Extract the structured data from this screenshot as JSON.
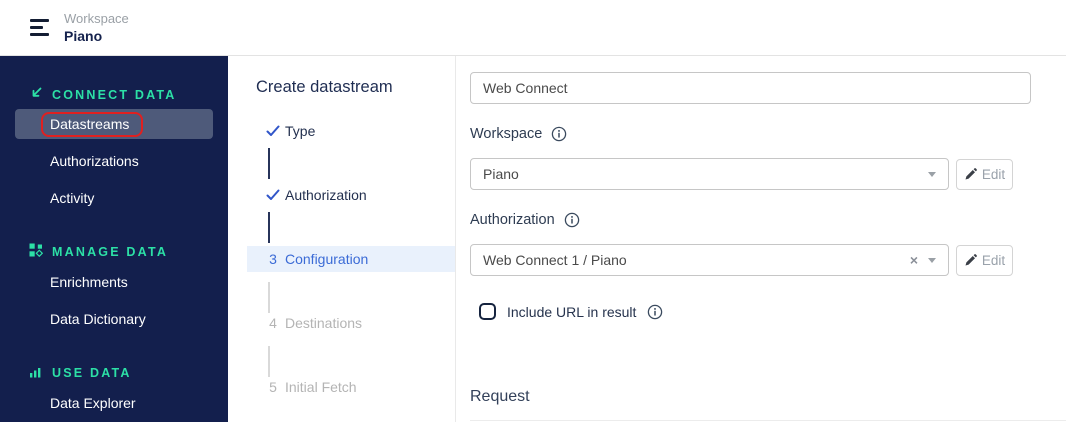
{
  "header": {
    "workspace_label": "Workspace",
    "workspace_name": "Piano"
  },
  "sidebar": {
    "sections": [
      {
        "title": "CONNECT DATA",
        "icon": "arrow-down-left-icon",
        "items": [
          {
            "label": "Datastreams",
            "selected": true,
            "annotated": true
          },
          {
            "label": "Authorizations"
          },
          {
            "label": "Activity"
          }
        ]
      },
      {
        "title": "MANAGE DATA",
        "icon": "modules-icon",
        "items": [
          {
            "label": "Enrichments"
          },
          {
            "label": "Data Dictionary"
          }
        ]
      },
      {
        "title": "USE DATA",
        "icon": "bar-chart-icon",
        "items": [
          {
            "label": "Data Explorer"
          }
        ]
      }
    ]
  },
  "wizard": {
    "title": "Create datastream",
    "steps": [
      {
        "label": "Type",
        "state": "completed"
      },
      {
        "label": "Authorization",
        "state": "completed"
      },
      {
        "number": "3",
        "label": "Configuration",
        "state": "active"
      },
      {
        "number": "4",
        "label": "Destinations",
        "state": "pending"
      },
      {
        "number": "5",
        "label": "Initial Fetch",
        "state": "pending"
      }
    ]
  },
  "form": {
    "name_value": "Web Connect",
    "workspace_label": "Workspace",
    "workspace_value": "Piano",
    "workspace_edit_label": "Edit",
    "authorization_label": "Authorization",
    "authorization_value": "Web Connect 1 / Piano",
    "authorization_edit_label": "Edit",
    "include_url_label": "Include URL in result",
    "include_url_checked": false,
    "request_heading": "Request"
  },
  "colors": {
    "sidebar_bg": "#131f4d",
    "sidebar_selected_bg": "#4e5a7a",
    "accent_teal": "#2ce0a6",
    "annotation_red": "#e02020",
    "active_step_blue": "#3b6bd6",
    "active_step_bg": "#e9f1fc",
    "check_blue": "#3156c9"
  }
}
